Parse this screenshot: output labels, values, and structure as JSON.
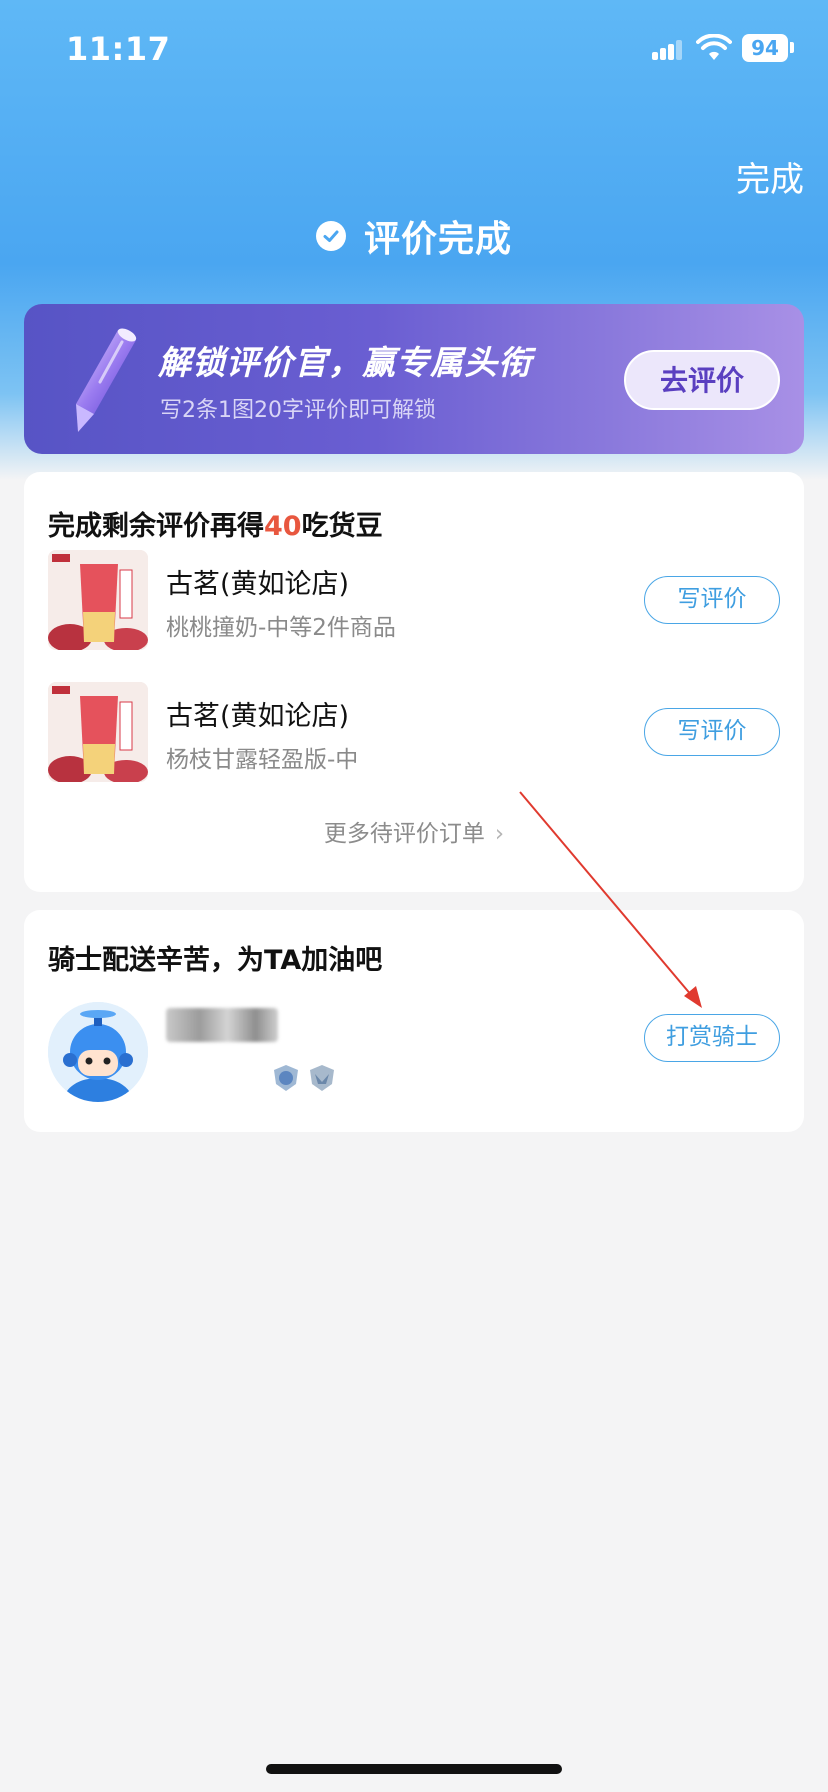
{
  "status_bar": {
    "time": "11:17",
    "battery": "94",
    "icons": [
      "signal-icon",
      "wifi-icon",
      "battery-icon"
    ]
  },
  "header": {
    "done_label": "完成",
    "title": "评价完成",
    "accent_color": "#4aa6f1"
  },
  "promo": {
    "title": "解锁评价官，赢专属头衔",
    "subtitle": "写2条1图20字评价即可解锁",
    "button_label": "去评价",
    "gradient": [
      "#5754c5",
      "#a890e6"
    ]
  },
  "review_card": {
    "heading_prefix": "完成剩余评价再得",
    "heading_highlight": "40",
    "heading_suffix": "吃货豆",
    "highlight_color": "#e8573f",
    "orders": [
      {
        "store": "古茗(黄如论店)",
        "desc": "桃桃撞奶-中等2件商品",
        "button_label": "写评价"
      },
      {
        "store": "古茗(黄如论店)",
        "desc": "杨枝甘露轻盈版-中",
        "button_label": "写评价"
      }
    ],
    "more_label": "更多待评价订单"
  },
  "rider_card": {
    "heading": "骑士配送辛苦，为TA加油吧",
    "button_label": "打赏骑士"
  }
}
